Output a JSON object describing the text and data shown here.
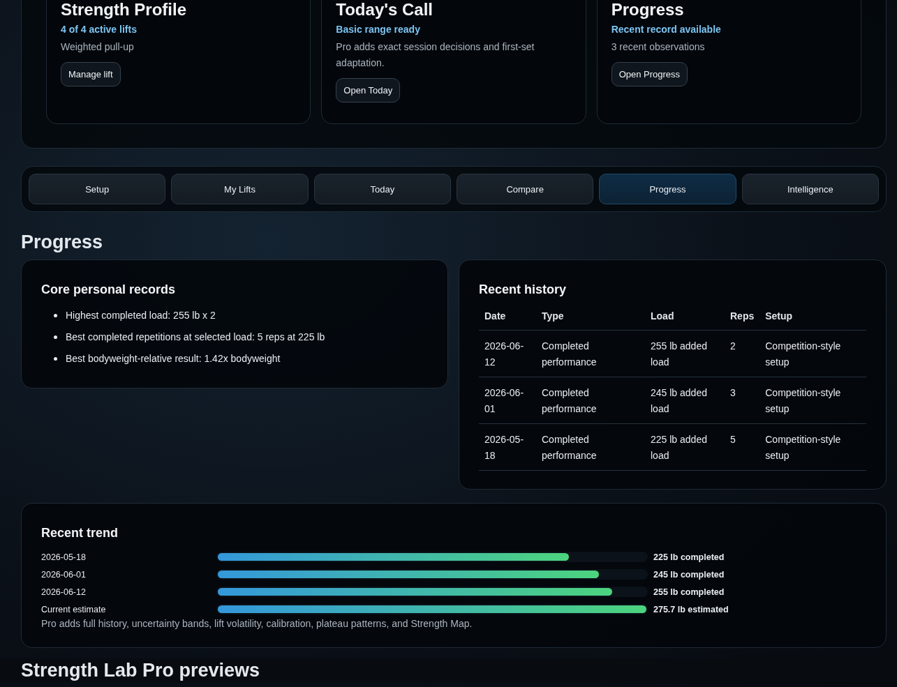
{
  "summary_cards": [
    {
      "title": "Strength Profile",
      "status": "4 of 4 active lifts",
      "detail": "Weighted pull-up",
      "button": "Manage lift"
    },
    {
      "title": "Today's Call",
      "status": "Basic range ready",
      "detail": "Pro adds exact session decisions and first-set adaptation.",
      "button": "Open Today"
    },
    {
      "title": "Progress",
      "status": "Recent record available",
      "detail": "3 recent observations",
      "button": "Open Progress"
    }
  ],
  "tabs": [
    {
      "label": "Setup",
      "selected": false
    },
    {
      "label": "My Lifts",
      "selected": false
    },
    {
      "label": "Today",
      "selected": false
    },
    {
      "label": "Compare",
      "selected": false
    },
    {
      "label": "Progress",
      "selected": true
    },
    {
      "label": "Intelligence",
      "selected": false
    }
  ],
  "section_title": "Progress",
  "records": {
    "title": "Core personal records",
    "items": [
      "Highest completed load: 255 lb x 2",
      "Best completed repetitions at selected load: 5 reps at 225 lb",
      "Best bodyweight-relative result: 1.42x bodyweight"
    ]
  },
  "history": {
    "title": "Recent history",
    "columns": [
      "Date",
      "Type",
      "Load",
      "Reps",
      "Setup"
    ],
    "rows": [
      [
        "2026-06-12",
        "Completed performance",
        "255 lb added load",
        "2",
        "Competition-style setup"
      ],
      [
        "2026-06-01",
        "Completed performance",
        "245 lb added load",
        "3",
        "Competition-style setup"
      ],
      [
        "2026-05-18",
        "Completed performance",
        "225 lb added load",
        "5",
        "Competition-style setup"
      ]
    ]
  },
  "trend": {
    "title": "Recent trend",
    "rows": [
      {
        "label": "2026-05-18",
        "level": 0.82,
        "reading": "225 lb completed"
      },
      {
        "label": "2026-06-01",
        "level": 0.89,
        "reading": "245 lb completed"
      },
      {
        "label": "2026-06-12",
        "level": 0.92,
        "reading": "255 lb completed"
      },
      {
        "label": "Current estimate",
        "level": 1.0,
        "reading": "275.7 lb estimated"
      }
    ],
    "note": "Pro adds full history, uncertainty bands, lift volatility, calibration, plateau patterns, and Strength Map."
  },
  "previews_title": "Strength Lab Pro previews"
}
